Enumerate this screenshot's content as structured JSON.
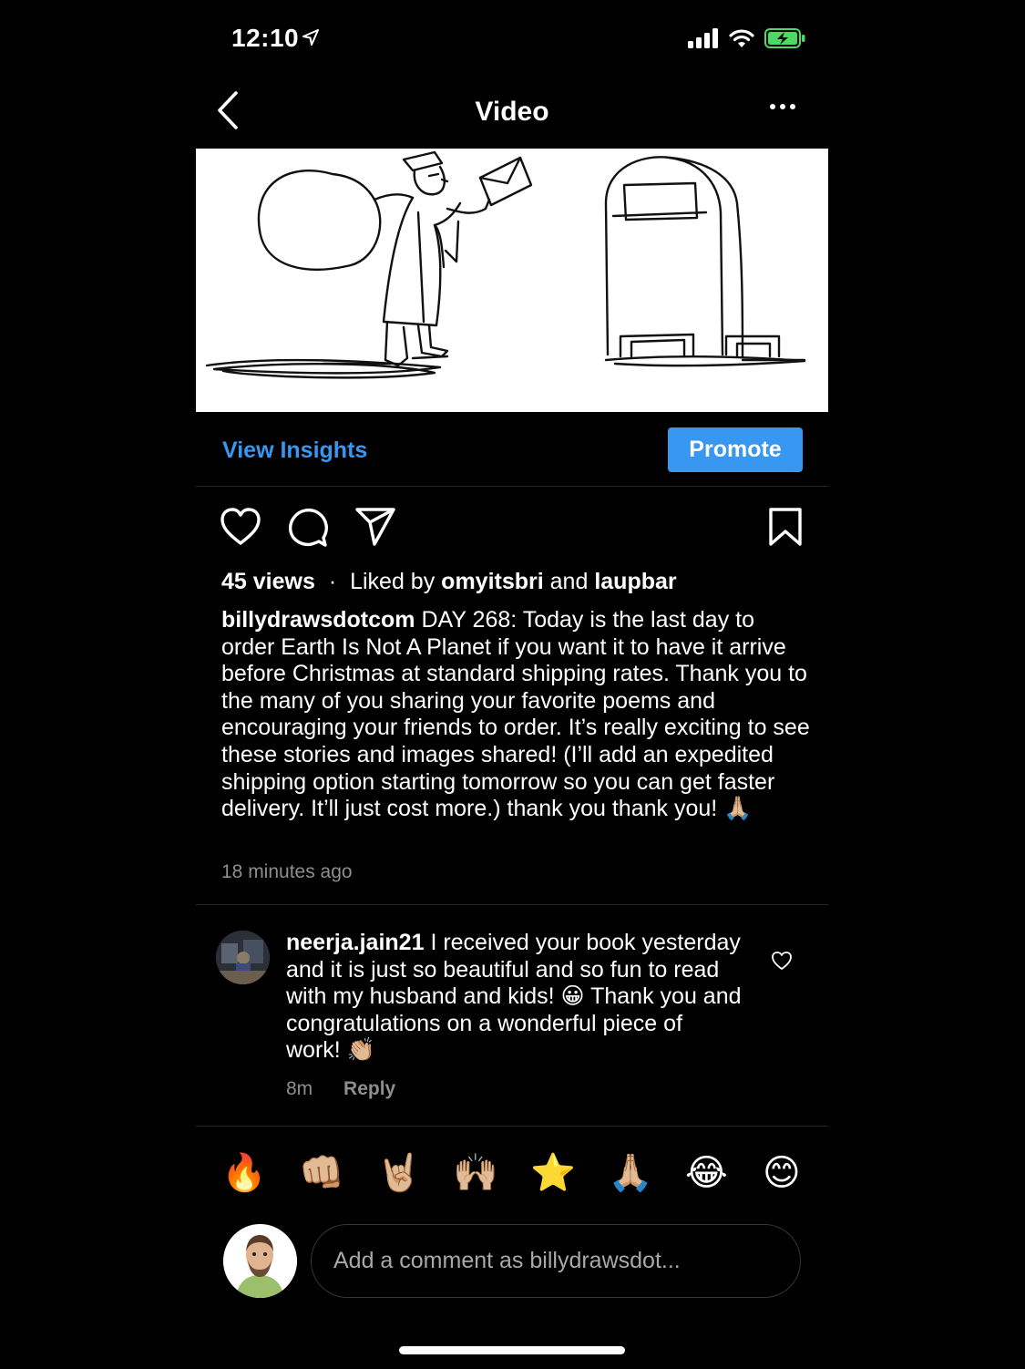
{
  "status": {
    "time": "12:10"
  },
  "nav": {
    "title": "Video"
  },
  "insights": {
    "view_label": "View Insights",
    "promote_label": "Promote"
  },
  "stats": {
    "views": "45 views",
    "separator": "·",
    "liked_prefix": "Liked by",
    "liker1": "omyitsbri",
    "and": "and",
    "liker2": "laupbar"
  },
  "caption": {
    "username": "billydrawsdotcom",
    "text": "DAY 268: Today is the last day to order Earth Is Not A Planet if you want it to have it arrive before Christmas at standard shipping rates. Thank you to the many of you sharing your favorite poems and encouraging your friends to order. It’s really exciting to see these stories and images shared! (I’ll add an expedited shipping option starting tomorrow so you can get faster delivery. It’ll just cost more.) thank you thank you! 🙏🏼",
    "time_ago": "18 minutes ago"
  },
  "comment": {
    "username": "neerja.jain21",
    "text": "I received your book yesterday and it is just so beautiful and so fun to read with my husband and kids! 😀 Thank you and congratulations on a wonderful piece of work! 👏🏼",
    "time": "8m",
    "reply_label": "Reply"
  },
  "quick_emojis": [
    "🔥",
    "👊🏼",
    "🤘🏼",
    "🙌🏼",
    "⭐",
    "🙏🏼",
    "😂",
    "😊"
  ],
  "comment_input": {
    "placeholder": "Add a comment as billydrawsdot..."
  },
  "colors": {
    "accent": "#3897f0",
    "background": "#000000",
    "muted": "#8e8e8e"
  },
  "icons": [
    "back-icon",
    "more-icon",
    "heart-icon",
    "comment-icon",
    "share-icon",
    "bookmark-icon",
    "signal-icon",
    "wifi-icon",
    "battery-icon",
    "location-arrow-icon"
  ]
}
